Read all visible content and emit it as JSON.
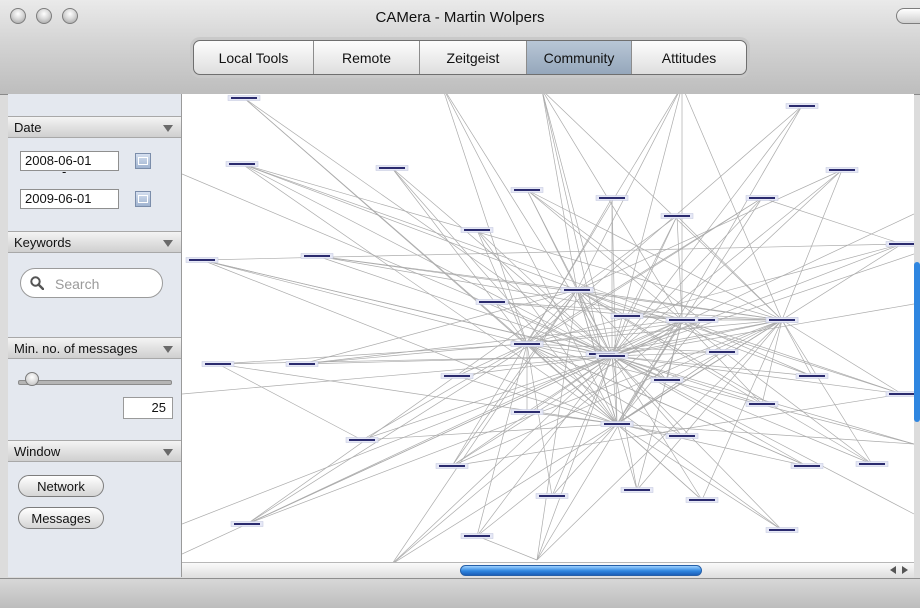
{
  "window": {
    "title": "CAMera - Martin Wolpers"
  },
  "tabs": [
    {
      "label": "Local Tools",
      "active": false
    },
    {
      "label": "Remote",
      "active": false
    },
    {
      "label": "Zeitgeist",
      "active": false
    },
    {
      "label": "Community",
      "active": true
    },
    {
      "label": "Attitudes",
      "active": false
    }
  ],
  "sidebar": {
    "date": {
      "header": "Date",
      "from": "2008-06-01",
      "separator": "-",
      "to": "2009-06-01"
    },
    "keywords": {
      "header": "Keywords",
      "search_placeholder": "Search"
    },
    "min_messages": {
      "header": "Min. no. of messages",
      "value": "25"
    },
    "window": {
      "header": "Window",
      "network_button": "Network",
      "messages_button": "Messages"
    }
  },
  "colors": {
    "active_tab": "#9fb0c4",
    "scroll_thumb": "#2f86e0",
    "node_label": "#2b2b6e",
    "edge": "#9a9a9a"
  },
  "icons": {
    "search": "search-icon",
    "calendar": "calendar-icon",
    "collapse": "triangle-down-icon"
  }
}
